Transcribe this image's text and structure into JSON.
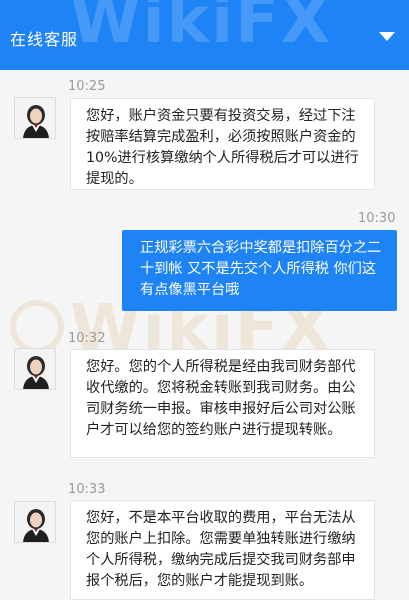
{
  "header": {
    "title": "在线客服",
    "toggle_icon": "chevron-down-icon",
    "background": "#1e83f5"
  },
  "watermark": {
    "text": "WikiFX"
  },
  "messages": [
    {
      "sender": "agent",
      "time": "10:25",
      "text": "您好，账户资金只要有投资交易，经过下注按赔率结算完成盈利，必须按照账户资金的10%进行核算缴纳个人所得税后才可以进行提现的。"
    },
    {
      "sender": "user",
      "time": "10:30",
      "text": "正规彩票六合彩中奖都是扣除百分之二十到帐 又不是先交个人所得税 你们这有点像黑平台哦"
    },
    {
      "sender": "agent",
      "time": "10:32",
      "text": "您好。您的个人所得税是经由我司财务部代收代缴的。您将税金转账到我司财务。由公司财务统一申报。审核申报好后公司对公账户才可以给您的签约账户进行提现转账。"
    },
    {
      "sender": "agent",
      "time": "10:33",
      "text": "您好，不是本平台收取的费用，平台无法从您的账户上扣除。您需要单独转账进行缴纳个人所得税，缴纳完成后提交我司财务部申报个税后，您的账户才能提现到账。"
    }
  ]
}
